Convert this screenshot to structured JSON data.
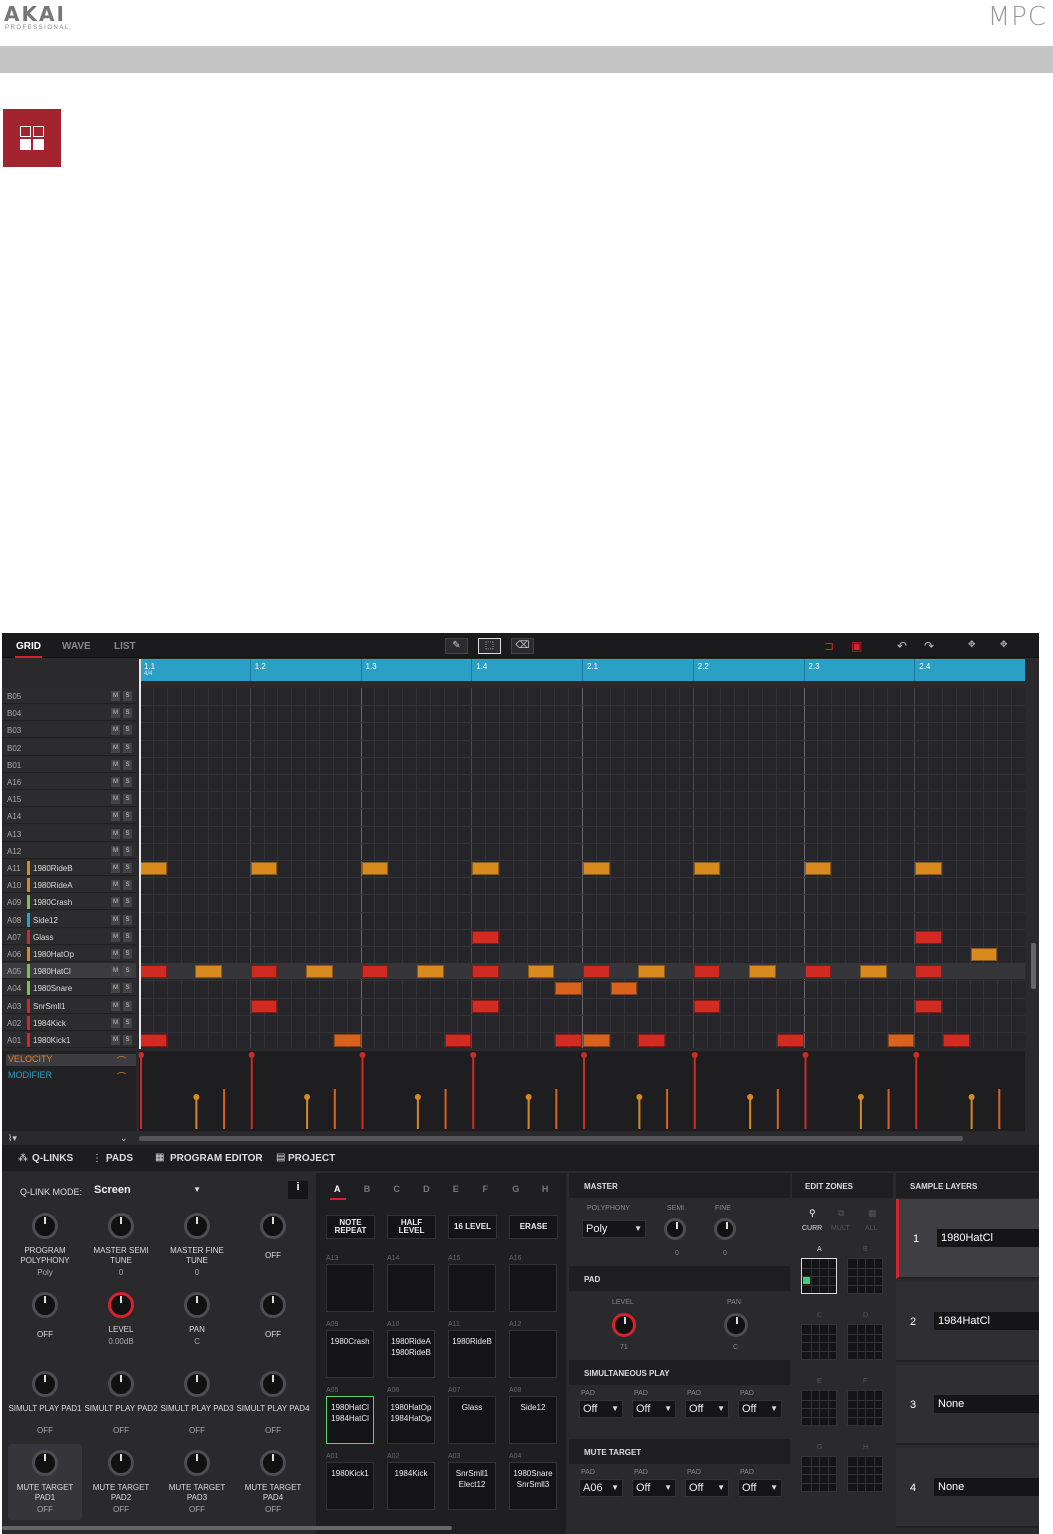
{
  "header": {
    "brand": "AKAI",
    "brand_sub": "PROFESSIONAL",
    "product": "MPC"
  },
  "colors": {
    "accent": "#d5222f",
    "ruler": "#2aa0c7",
    "note_orange": "#d88a1e",
    "note_red": "#d32a22"
  },
  "mode_icon": "grid-mode-icon",
  "toolbar": {
    "tabs": [
      "GRID",
      "WAVE",
      "LIST"
    ],
    "active_tab": "GRID"
  },
  "ruler": {
    "bars": [
      "1.1",
      "1.2",
      "1.3",
      "1.4",
      "2.1",
      "2.2",
      "2.3",
      "2.4"
    ],
    "time_signature": "4/4"
  },
  "lanes": [
    {
      "pad": "B05",
      "name": ""
    },
    {
      "pad": "B04",
      "name": ""
    },
    {
      "pad": "B03",
      "name": ""
    },
    {
      "pad": "B02",
      "name": ""
    },
    {
      "pad": "B01",
      "name": ""
    },
    {
      "pad": "A16",
      "name": ""
    },
    {
      "pad": "A15",
      "name": ""
    },
    {
      "pad": "A14",
      "name": ""
    },
    {
      "pad": "A13",
      "name": ""
    },
    {
      "pad": "A12",
      "name": ""
    },
    {
      "pad": "A11",
      "name": "1980RideB"
    },
    {
      "pad": "A10",
      "name": "1980RideA"
    },
    {
      "pad": "A09",
      "name": "1980Crash"
    },
    {
      "pad": "A08",
      "name": "Side12"
    },
    {
      "pad": "A07",
      "name": "Glass"
    },
    {
      "pad": "A06",
      "name": "1980HatOp"
    },
    {
      "pad": "A05",
      "name": "1980HatCl"
    },
    {
      "pad": "A04",
      "name": "1980Snare"
    },
    {
      "pad": "A03",
      "name": "SnrSmll1"
    },
    {
      "pad": "A02",
      "name": "1984Kick"
    },
    {
      "pad": "A01",
      "name": "1980Kick1"
    }
  ],
  "lane_buttons": {
    "mute": "M",
    "solo": "S"
  },
  "automation": {
    "velocity": "VELOCITY",
    "modifier": "MODIFIER"
  },
  "bottom_tabs": [
    "Q-LINKS",
    "PADS",
    "PROGRAM EDITOR",
    "PROJECT"
  ],
  "qlink": {
    "mode_label": "Q-LINK MODE:",
    "mode_value": "Screen",
    "knobs": [
      {
        "label": "PROGRAM POLYPHONY",
        "value": "Poly"
      },
      {
        "label": "MASTER SEMI TUNE",
        "value": "0"
      },
      {
        "label": "MASTER FINE TUNE",
        "value": "0"
      },
      {
        "label": "OFF",
        "value": ""
      },
      {
        "label": "OFF",
        "value": ""
      },
      {
        "label": "LEVEL",
        "value": "0.00dB"
      },
      {
        "label": "PAN",
        "value": "C"
      },
      {
        "label": "OFF",
        "value": ""
      },
      {
        "label": "SIMULT PLAY PAD1",
        "value": "OFF"
      },
      {
        "label": "SIMULT PLAY PAD2",
        "value": "OFF"
      },
      {
        "label": "SIMULT PLAY PAD3",
        "value": "OFF"
      },
      {
        "label": "SIMULT PLAY PAD4",
        "value": "OFF"
      },
      {
        "label": "MUTE TARGET PAD1",
        "value": "OFF"
      },
      {
        "label": "MUTE TARGET PAD2",
        "value": "OFF"
      },
      {
        "label": "MUTE TARGET PAD3",
        "value": "OFF"
      },
      {
        "label": "MUTE TARGET PAD4",
        "value": "OFF"
      }
    ]
  },
  "pads": {
    "banks": [
      "A",
      "B",
      "C",
      "D",
      "E",
      "F",
      "G",
      "H"
    ],
    "active_bank": "A",
    "buttons": [
      "NOTE REPEAT",
      "HALF LEVEL",
      "16 LEVEL",
      "ERASE"
    ],
    "rows": [
      [
        {
          "id": "A13",
          "name": ""
        },
        {
          "id": "A14",
          "name": ""
        },
        {
          "id": "A15",
          "name": ""
        },
        {
          "id": "A16",
          "name": ""
        }
      ],
      [
        {
          "id": "A09",
          "name": "1980Crash"
        },
        {
          "id": "A10",
          "name": "1980RideA 1980RideB"
        },
        {
          "id": "A11",
          "name": "1980RideB"
        },
        {
          "id": "A12",
          "name": ""
        }
      ],
      [
        {
          "id": "A05",
          "name": "1980HatCl 1984HatCl"
        },
        {
          "id": "A06",
          "name": "1980HatOp 1984HatOp"
        },
        {
          "id": "A07",
          "name": "Glass"
        },
        {
          "id": "A08",
          "name": "Side12"
        }
      ],
      [
        {
          "id": "A01",
          "name": "1980Kick1"
        },
        {
          "id": "A02",
          "name": "1984Kick"
        },
        {
          "id": "A03",
          "name": "SnrSmll1 Elect12"
        },
        {
          "id": "A04",
          "name": "1980Snare SnrSmll3"
        }
      ]
    ]
  },
  "master": {
    "title": "MASTER",
    "polyphony_label": "POLYPHONY",
    "polyphony_value": "Poly",
    "semi_label": "SEMI",
    "semi_value": "0",
    "fine_label": "FINE",
    "fine_value": "0"
  },
  "pad_section": {
    "title": "PAD",
    "level_label": "LEVEL",
    "level_value": "71",
    "pan_label": "PAN",
    "pan_value": "C"
  },
  "simultaneous": {
    "title": "SIMULTANEOUS PLAY",
    "pad_label": "PAD",
    "values": [
      "Off",
      "Off",
      "Off",
      "Off"
    ]
  },
  "mute_target": {
    "title": "MUTE TARGET",
    "pad_label": "PAD",
    "values": [
      "A06",
      "Off",
      "Off",
      "Off"
    ]
  },
  "edit_zones": {
    "title": "EDIT ZONES",
    "modes": [
      "CURR",
      "MULT",
      "ALL"
    ],
    "zones": [
      "A",
      "B",
      "C",
      "D",
      "E",
      "F",
      "G",
      "H"
    ]
  },
  "sample_layers": {
    "title": "SAMPLE LAYERS",
    "layers": [
      {
        "num": "1",
        "name": "1980HatCl"
      },
      {
        "num": "2",
        "name": "1984HatCl"
      },
      {
        "num": "3",
        "name": "None"
      },
      {
        "num": "4",
        "name": "None"
      }
    ]
  }
}
